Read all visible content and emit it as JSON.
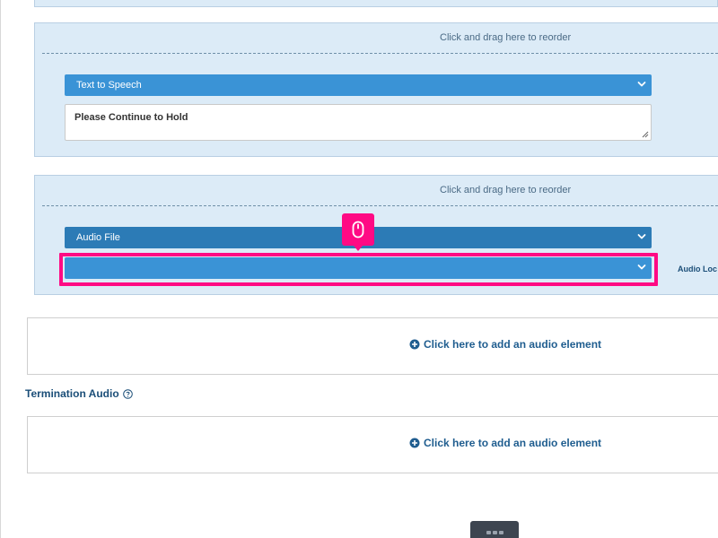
{
  "colors": {
    "accent": "#3a93d6",
    "accent_dark": "#2c7bb6",
    "panel_bg": "#dcebf7",
    "highlight": "#ff0a84",
    "link": "#1f5d8f"
  },
  "audio_blocks": [
    {
      "drag_hint": "Click and drag here to reorder",
      "type_select": {
        "selected": "Text to Speech",
        "icon": "chevron-down-icon"
      },
      "text_value": "Please Continue to Hold"
    },
    {
      "drag_hint": "Click and drag here to reorder",
      "type_select": {
        "selected": "Audio File",
        "icon": "chevron-down-icon"
      },
      "location_select": {
        "selected": "",
        "icon": "chevron-down-icon"
      },
      "location_label": "Audio Loc"
    }
  ],
  "add_element": {
    "icon": "plus-circle-icon",
    "label": "Click here to add an audio element"
  },
  "termination_audio": {
    "title": "Termination Audio",
    "help_icon": "question-circle-icon",
    "add_label": "Click here to add an audio element"
  },
  "cursor_indicator": {
    "icon": "mouse-icon"
  },
  "bottom_tab": {
    "icon": "drag-handle-icon"
  }
}
